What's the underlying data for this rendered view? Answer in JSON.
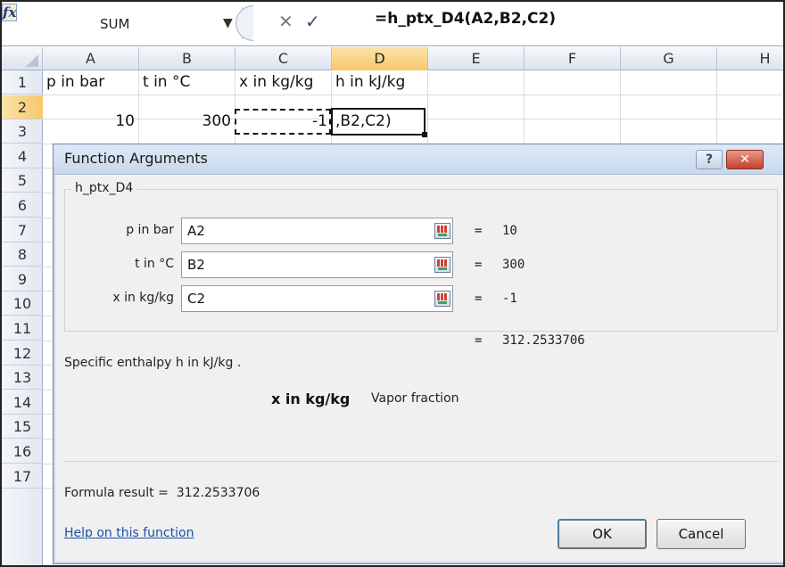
{
  "formula_bar": {
    "name_box": "SUM",
    "formula": "=h_ptx_D4(A2,B2,C2)",
    "cancel_glyph": "✕",
    "enter_glyph": "✓",
    "fx_label": "fx",
    "dropdown_glyph": "▼"
  },
  "sheet": {
    "columns": [
      "A",
      "B",
      "C",
      "D",
      "E",
      "F",
      "G",
      "H"
    ],
    "selected_column": "D",
    "rows": [
      "1",
      "2",
      "3",
      "4",
      "5",
      "6",
      "7",
      "8",
      "9",
      "10",
      "11",
      "12",
      "13",
      "14",
      "15",
      "16",
      "17"
    ],
    "selected_row": "2",
    "row1": {
      "a": "p in bar",
      "b": "t in °C",
      "c": "x in kg/kg",
      "d": "h in kJ/kg"
    },
    "row2": {
      "a": "10",
      "b": "300",
      "c": "-1",
      "d": ",B2,C2)"
    }
  },
  "dialog": {
    "title": "Function Arguments",
    "help_glyph": "?",
    "close_glyph": "✕",
    "function_name": "h_ptx_D4",
    "args": [
      {
        "label": "p in bar",
        "value": "A2",
        "eq": "=",
        "result": "10"
      },
      {
        "label": "t in °C",
        "value": "B2",
        "eq": "=",
        "result": "300"
      },
      {
        "label": "x in kg/kg",
        "value": "C2",
        "eq": "=",
        "result": "-1"
      }
    ],
    "result_eq": "=",
    "result_value": "312.2533706",
    "description": "Specific enthalpy h in kJ/kg .",
    "arg_desc_name": "x in kg/kg",
    "arg_desc_text": "Vapor fraction",
    "formula_result_label": "Formula result =",
    "formula_result_value": "312.2533706",
    "help_link": "Help on this function",
    "ok_label": "OK",
    "cancel_label": "Cancel"
  },
  "colors": {
    "selected_header": "#f7c86a",
    "title_bar": "#c8d8ec",
    "close_button": "#c2422c",
    "link": "#1f4fa6"
  }
}
